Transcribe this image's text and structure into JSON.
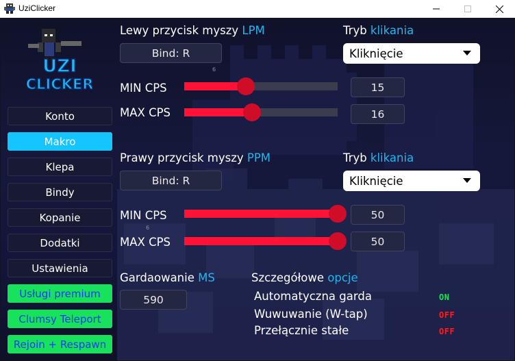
{
  "window": {
    "title": "UziClicker"
  },
  "logo": {
    "line1": "UZI",
    "line2": "CLICKER"
  },
  "sidebar": {
    "items": [
      {
        "label": "Konto"
      },
      {
        "label": "Makro"
      },
      {
        "label": "Klepa"
      },
      {
        "label": "Bindy"
      },
      {
        "label": "Kopanie"
      },
      {
        "label": "Dodatki"
      },
      {
        "label": "Ustawienia"
      },
      {
        "label": "Usługi premium"
      },
      {
        "label": "Clumsy Teleport"
      },
      {
        "label": "Rejoin + Respawn"
      }
    ],
    "active_index": 1
  },
  "lpm": {
    "title": "Lewy przycisk myszy ",
    "title_accent": "LPM",
    "bind_label": "Bind: R",
    "mode_label": "Tryb ",
    "mode_accent": "klikania",
    "mode_value": "Kliknięcie",
    "min_label": "MIN CPS",
    "max_label": "MAX CPS",
    "min_value": "15",
    "max_value": "16",
    "min_level": 0.4,
    "max_level": 0.44,
    "hint": "6"
  },
  "ppm": {
    "title": "Prawy przycisk myszy ",
    "title_accent": "PPM",
    "bind_label": "Bind: R",
    "mode_label": "Tryb ",
    "mode_accent": "klikania",
    "mode_value": "Kliknięcie",
    "min_label": "MIN CPS",
    "max_label": "MAX CPS",
    "min_value": "50",
    "max_value": "50",
    "min_level": 1.0,
    "max_level": 1.0,
    "hint": "6"
  },
  "guard": {
    "label": "Gardaowanie ",
    "label_accent": "MS",
    "value": "590"
  },
  "options": {
    "title": "Szczegółowe ",
    "title_accent": "opcje",
    "items": [
      {
        "label": "Automatyczna garda",
        "state": "ON"
      },
      {
        "label": "Wuwuwanie (W-tap)",
        "state": "OFF"
      },
      {
        "label": "Przełącznie stałe",
        "state": "OFF"
      }
    ]
  },
  "colors": {
    "accent": "#23b6f0",
    "active_tab": "#14c5ff",
    "premium": "#18e25c",
    "slider_fill": "#ff1236",
    "on": "#1fe05a",
    "off": "#ff1e1e"
  }
}
